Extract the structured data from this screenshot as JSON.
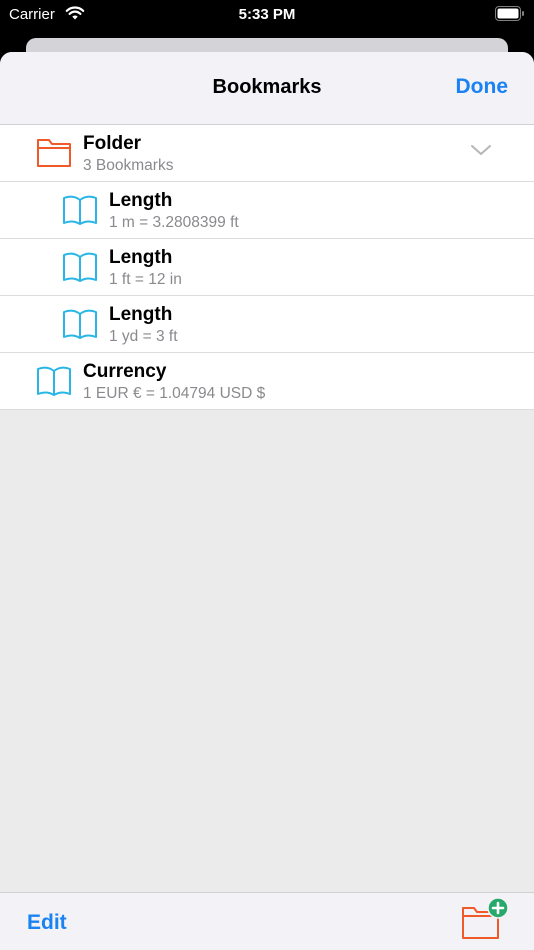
{
  "status_bar": {
    "carrier": "Carrier",
    "time": "5:33 PM"
  },
  "nav": {
    "title": "Bookmarks",
    "done_label": "Done"
  },
  "colors": {
    "accent": "#1a82f2",
    "folder": "#f05a28",
    "bookmark": "#29b6e6",
    "add_badge": "#27a96b"
  },
  "list": {
    "rows": [
      {
        "type": "folder",
        "icon": "folder-icon",
        "title": "Folder",
        "subtitle": "3 Bookmarks",
        "expanded": true
      },
      {
        "type": "bookmark",
        "icon": "book-icon",
        "title": "Length",
        "subtitle": "1 m = 3.2808399 ft"
      },
      {
        "type": "bookmark",
        "icon": "book-icon",
        "title": "Length",
        "subtitle": "1 ft = 12 in"
      },
      {
        "type": "bookmark",
        "icon": "book-icon",
        "title": "Length",
        "subtitle": "1 yd = 3 ft"
      },
      {
        "type": "bookmark",
        "icon": "book-icon",
        "title": "Currency",
        "subtitle": "1 EUR € = 1.04794 USD $"
      }
    ]
  },
  "toolbar": {
    "edit_label": "Edit",
    "add_folder_icon": "folder-add-icon"
  }
}
